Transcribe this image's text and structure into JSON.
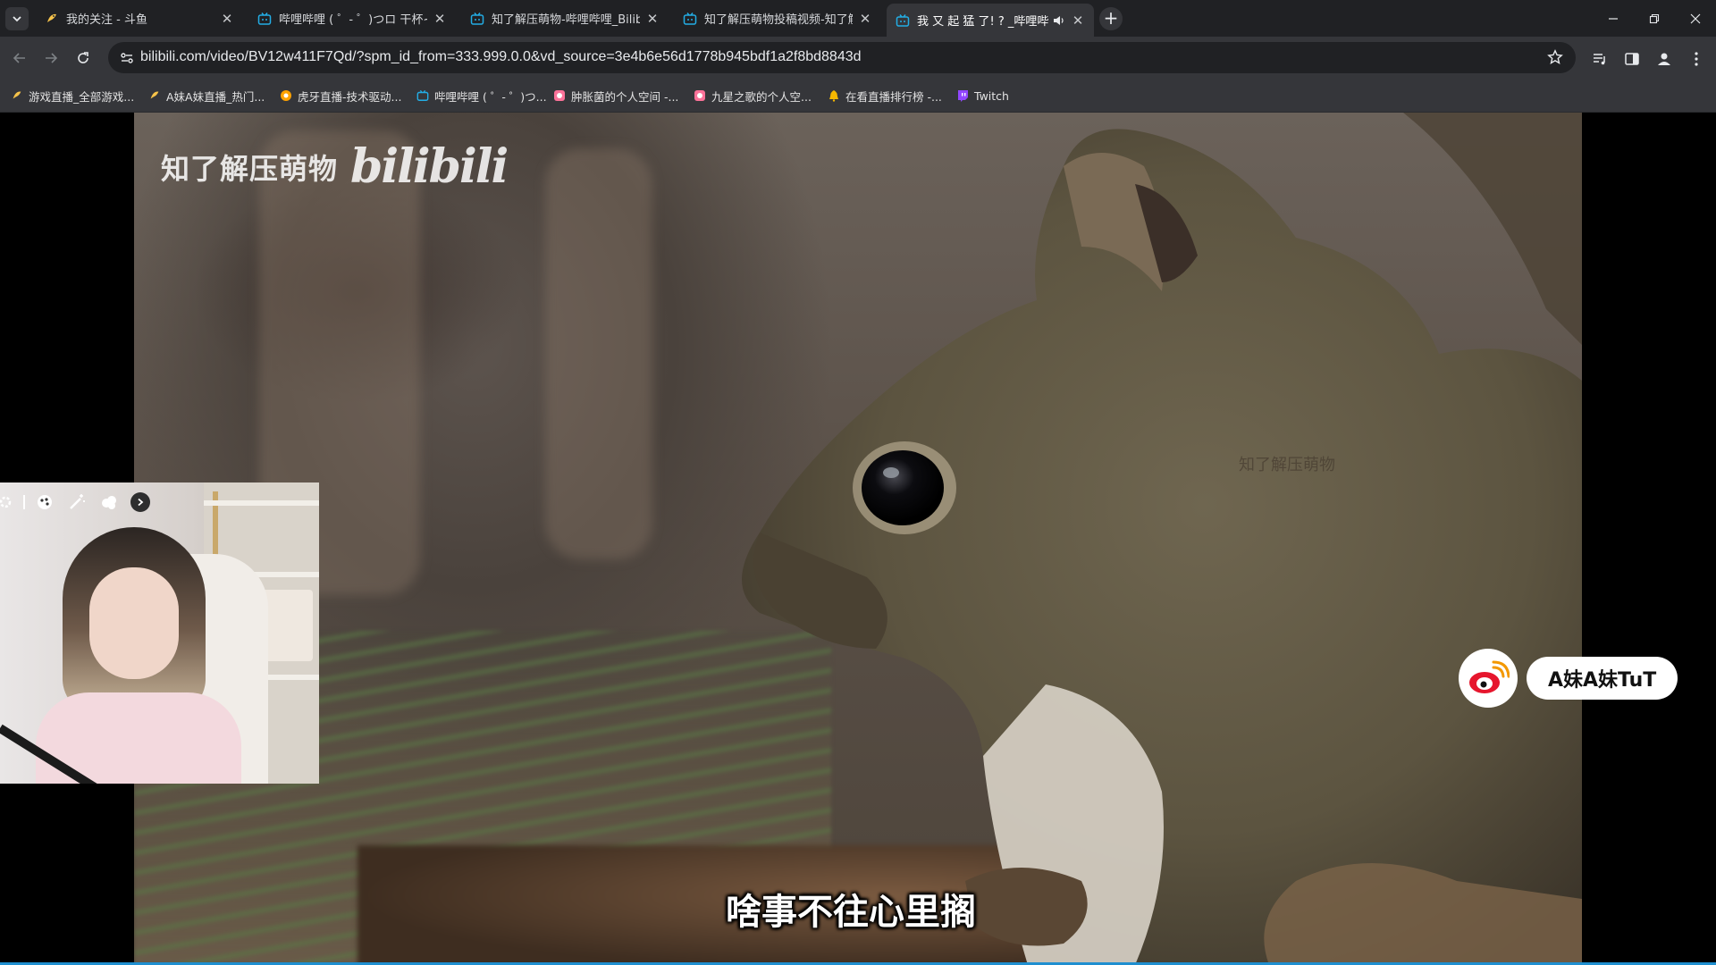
{
  "tabs": [
    {
      "title": "我的关注 - 斗鱼",
      "favicon": "douyu-fish-icon"
    },
    {
      "title": "哔哩哔哩 ( ゜- ゜)つロ 干杯~-bi",
      "favicon": "bilibili-tv-icon"
    },
    {
      "title": "知了解压萌物-哔哩哔哩_Bilibili",
      "favicon": "bilibili-tv-icon"
    },
    {
      "title": "知了解压萌物投稿视频-知了解",
      "favicon": "bilibili-tv-icon"
    },
    {
      "title": "我 又 起 猛 了! ? _哔哩哔",
      "favicon": "bilibili-tv-icon",
      "active": true,
      "audio": true
    }
  ],
  "window_controls": {
    "minimize": "—",
    "restore": "❐",
    "close": "✕"
  },
  "address_bar": {
    "url": "bilibili.com/video/BV12w411F7Qd/?spm_id_from=333.999.0.0&vd_source=3e4b6e56d1778b945bdf1a2f8bd8843d"
  },
  "bookmarks": [
    {
      "label": "游戏直播_全部游戏...",
      "icon": "douyu-fish-icon"
    },
    {
      "label": "A妹A妹直播_热门...",
      "icon": "douyu-fish-icon"
    },
    {
      "label": "虎牙直播-技术驱动...",
      "icon": "huya-icon"
    },
    {
      "label": "哔哩哔哩 ( ゜- ゜)つ...",
      "icon": "bilibili-tv-icon"
    },
    {
      "label": "肿胀菌的个人空间 -...",
      "icon": "space-icon"
    },
    {
      "label": "九星之歌的个人空...",
      "icon": "space-icon"
    },
    {
      "label": "在看直播排行榜 -...",
      "icon": "bell-icon"
    },
    {
      "label": "Twitch",
      "icon": "twitch-icon"
    }
  ],
  "video": {
    "logo_text_cn": "知了解压萌物",
    "logo_text_en": "bilibili",
    "watermark": "知了解压萌物",
    "subtitle": "啥事不往心里搁"
  },
  "streamer_badge": {
    "name": "A妹A妹TuT",
    "platform_icon": "weibo-icon"
  },
  "colors": {
    "tabstrip": "#202124",
    "toolbar": "#35363a",
    "omnibox": "#202124",
    "progress": "#1f8fd0"
  }
}
